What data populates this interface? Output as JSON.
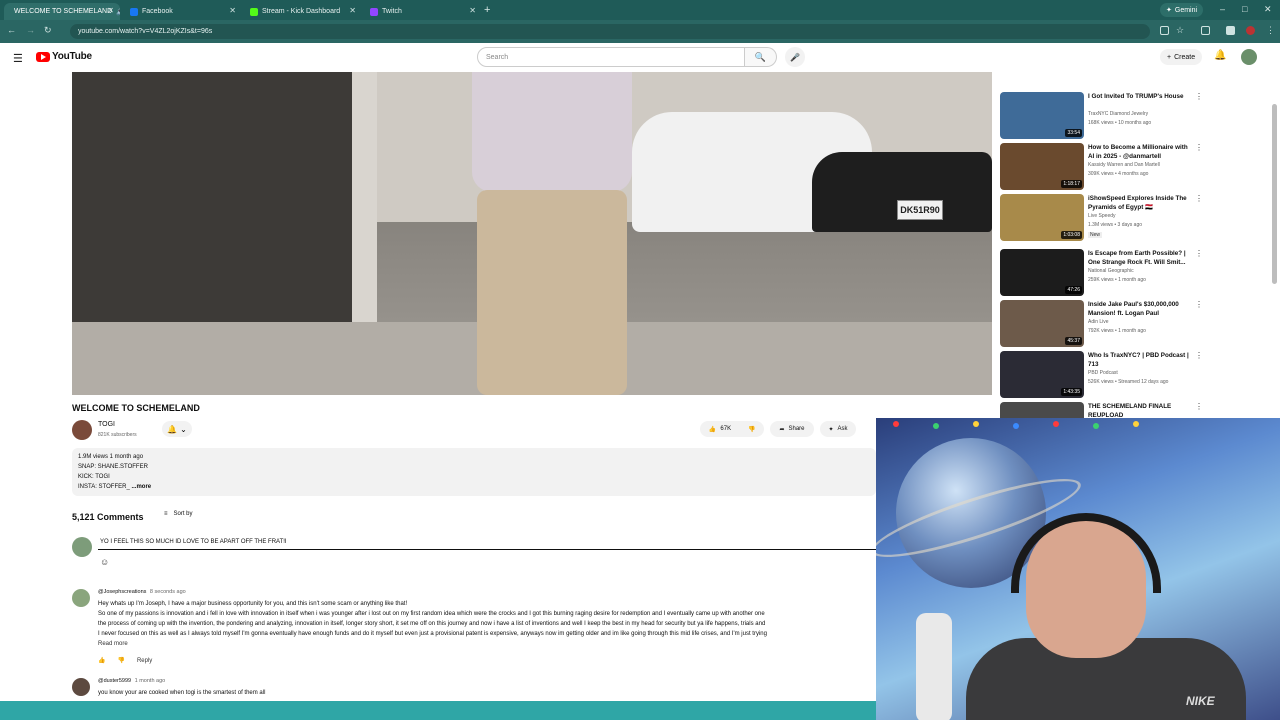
{
  "browser": {
    "tabs": [
      {
        "label": "WELCOME TO SCHEMELAND",
        "active": true,
        "favicon_color": "#ff3333"
      },
      {
        "label": "Facebook",
        "active": false,
        "favicon_color": "#1877f2"
      },
      {
        "label": "Stream - Kick Dashboard",
        "active": false,
        "favicon_color": "#53fc18"
      },
      {
        "label": "Twitch",
        "active": false,
        "favicon_color": "#9146ff"
      }
    ],
    "new_tab": "+",
    "gemini_label": "Gemini",
    "url": "youtube.com/watch?v=V4ZL2ojKZIs&t=96s"
  },
  "youtube": {
    "logo_text": "YouTube",
    "search_placeholder": "Search",
    "create_label": "Create"
  },
  "video": {
    "plate_text": "DK51R90",
    "title": "WELCOME TO SCHEMELAND",
    "channel": "TOGI",
    "subscribers": "821K subscribers",
    "likes": "67K",
    "share_label": "Share",
    "ask_label": "Ask",
    "description": {
      "stats": "1.9M views  1 month ago",
      "line1": "SNAP: SHANE.STOFFER",
      "line2": "KICK: TOGI",
      "line3": "INSTA: STOFFER_",
      "more": "...more"
    }
  },
  "comments": {
    "count_label": "5,121 Comments",
    "sort_label": "Sort by",
    "draft": "YO I FEEL THIS SO MUCH ID LOVE TO BE APART OFF THE FRAT!I",
    "items": [
      {
        "handle": "@Josephscreations",
        "time": "8 seconds ago",
        "lines": [
          "Hey whats up I'm Joseph, I have a major business opportunity for you, and this isn't some scam or anything like that!",
          "  So one of my passions is innovation and i fell in love with innovation in itself when i was younger after i lost out on my first random idea which were the crocks and I got this burning raging desire for redemption and I eventually came up with another one",
          "the process of coming up with the invention, the pondering and analyzing, innovation in itself, longer story short, it set me off on this journey and now i have a list of inventions and well I keep the best in my head for security but ya life happens, trials and",
          "I never focused on this as well as I always told myself I'm gonna eventually have enough funds and do it myself but even just a provisional patent is expensive, anyways now im getting older and im like going through this mid life crises, and I'm just trying"
        ],
        "read_more": "Read more",
        "reply": "Reply",
        "avatar_color": "#8aa57d"
      },
      {
        "handle": "@duster5999",
        "time": "1 month ago",
        "lines": [
          "you know your are cooked when togi is the smartest of them all"
        ],
        "avatar_color": "#5d4a40"
      }
    ]
  },
  "sidebar": {
    "items": [
      {
        "title": "I Got Invited To TRUMP's House",
        "channel": "TraxNYC Diamond Jewelry",
        "stats": "168K views  • 10 months ago",
        "duration": "33:54",
        "thumb": "#3f6b98"
      },
      {
        "title": "How to Become a Millionaire with AI in 2025 - @danmartell",
        "channel": "Kassidy Warren and Dan Martell",
        "stats": "309K views  • 4 months ago",
        "duration": "1:18:17",
        "thumb": "#6a4a2e"
      },
      {
        "title": "iShowSpeed Explores Inside The Pyramids of Egypt 🇪🇬",
        "channel": "Live Speedy",
        "stats": "1.3M views  • 3 days ago",
        "duration": "1:03:08",
        "badge": "New",
        "thumb": "#a88a4a"
      },
      {
        "title": "Is Escape from Earth Possible? | One Strange Rock Ft. Will Smit...",
        "channel": "National Geographic",
        "stats": "259K views  • 1 month ago",
        "duration": "47:26",
        "thumb": "#1c1c1c"
      },
      {
        "title": "Inside Jake Paul's $30,000,000 Mansion! ft. Logan Paul",
        "channel": "Adin Live",
        "stats": "792K views  • 1 month ago",
        "duration": "45:37",
        "thumb": "#6d5a4a"
      },
      {
        "title": "Who Is TraxNYC? | PBD Podcast | 713",
        "channel": "PBD Podcast",
        "stats": "526K views  • Streamed 12 days ago",
        "duration": "1:43:35",
        "thumb": "#2b2b35"
      },
      {
        "title": "THE SCHEMELAND FINALE REUPLOAD",
        "channel": "",
        "stats": "",
        "duration": "",
        "thumb": "#4a4a4a"
      }
    ]
  },
  "webcam": {
    "shirt_logo": "NIKE"
  },
  "colors": {
    "tab_bar": "#1f5b58",
    "youtube_red": "#ff0000",
    "bottom_bar": "#2fa6a6"
  }
}
